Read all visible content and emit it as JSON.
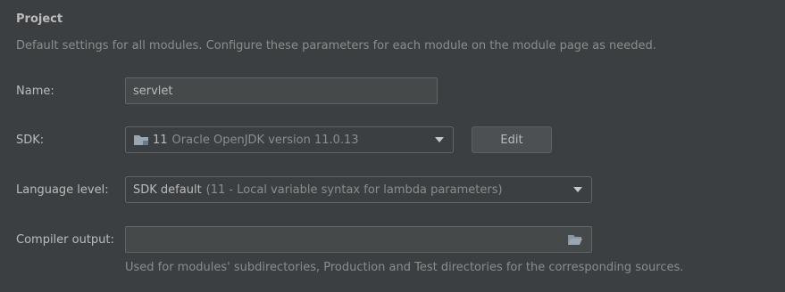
{
  "project": {
    "title": "Project",
    "description": "Default settings for all modules. Configure these parameters for each module on the module page as needed."
  },
  "name": {
    "label": "Name:",
    "value": "servlet"
  },
  "sdk": {
    "label": "SDK:",
    "version_number": "11",
    "version_detail": "Oracle OpenJDK version 11.0.13",
    "edit_label": "Edit"
  },
  "language_level": {
    "label": "Language level:",
    "value": "SDK default",
    "detail": "(11 - Local variable syntax for lambda parameters)"
  },
  "compiler_output": {
    "label": "Compiler output:",
    "value": "",
    "helper": "Used for modules' subdirectories, Production and Test directories for the corresponding sources."
  },
  "colors": {
    "background": "#3c3f41",
    "field_background": "#45494a",
    "border": "#646464",
    "text": "#bbbbbb",
    "muted_text": "#8c8c8c",
    "folder_icon": "#9aa7b0"
  },
  "icons": {
    "sdk_folder": "folder-icon",
    "dropdown": "chevron-down-icon",
    "browse": "folder-open-icon"
  }
}
